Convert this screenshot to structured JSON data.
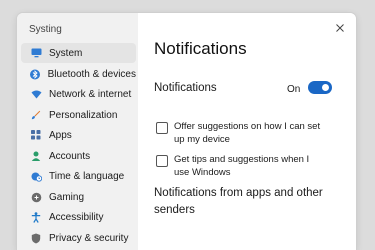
{
  "window": {
    "app_title": "Systing"
  },
  "sidebar": {
    "items": [
      {
        "label": "System",
        "icon": "monitor-icon",
        "selected": true
      },
      {
        "label": "Bluetooth & devices",
        "icon": "bluetooth-icon"
      },
      {
        "label": "Network & internet",
        "icon": "wifi-icon"
      },
      {
        "label": "Personalization",
        "icon": "brush-icon"
      },
      {
        "label": "Apps",
        "icon": "apps-grid-icon"
      },
      {
        "label": "Accounts",
        "icon": "person-icon"
      },
      {
        "label": "Time & language",
        "icon": "globe-clock-icon"
      },
      {
        "label": "Gaming",
        "icon": "gamepad-icon"
      },
      {
        "label": "Accessibility",
        "icon": "accessibility-icon"
      },
      {
        "label": "Privacy & security",
        "icon": "shield-icon"
      }
    ]
  },
  "main": {
    "title": "Notifications",
    "notifications_label": "Notifications",
    "toggle": {
      "state_label": "On",
      "on": true,
      "color": "#1a67c5"
    },
    "options": [
      {
        "label": "Offer suggestions on how I can set up my device",
        "checked": false
      },
      {
        "label": "Get tips and suggestions when I use Windows",
        "checked": false
      }
    ],
    "section_heading": "Notifications from apps and other senders"
  },
  "colors": {
    "accent": "#1a67c5",
    "selected_nav": "#e4e4e4"
  }
}
